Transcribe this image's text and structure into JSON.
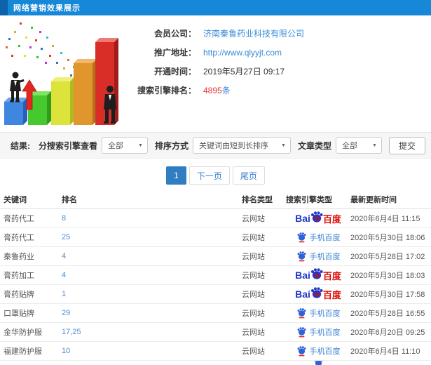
{
  "header": {
    "title": "网络营销效果展示"
  },
  "info": {
    "fields": [
      {
        "label": "会员公司：",
        "value": "济南秦鲁药业科技有限公司"
      },
      {
        "label": "推广地址：",
        "value": "http://www.qlyyjt.com"
      },
      {
        "label": "开通时间：",
        "value": "2019年5月27日 09:17"
      },
      {
        "label": "搜索引擎排名：",
        "value": "4895",
        "suffix": "条"
      }
    ]
  },
  "filters": {
    "result_label": "结果:",
    "engine_label": "分搜索引擎查看",
    "engine_value": "全部",
    "sort_label": "排序方式",
    "sort_value": "关键词由短到长排序",
    "article_label": "文章类型",
    "article_value": "全部",
    "submit_label": "提交"
  },
  "icons": {
    "dropdown_caret": "▼"
  },
  "pagination": {
    "current": "1",
    "next_label": "下一页",
    "last_label": "尾页"
  },
  "logos": {
    "baidu": {
      "bai": "Bai",
      "du": "du",
      "cn": "百度"
    },
    "mobile": {
      "cn": "手机百度"
    }
  },
  "table": {
    "headers": [
      "关键词",
      "排名",
      "排名类型",
      "搜索引擎类型",
      "最新更新时间"
    ],
    "rows": [
      {
        "keyword": "膏药代工",
        "rank": "8",
        "rank_type": "云网站",
        "engine": "baidu",
        "updated": "2020年6月4日 11:15"
      },
      {
        "keyword": "膏药代工",
        "rank": "25",
        "rank_type": "云网站",
        "engine": "mobile",
        "updated": "2020年5月30日 18:06"
      },
      {
        "keyword": "秦鲁药业",
        "rank": "4",
        "rank_type": "云网站",
        "engine": "mobile",
        "updated": "2020年5月28日 17:02"
      },
      {
        "keyword": "膏药加工",
        "rank": "4",
        "rank_type": "云网站",
        "engine": "baidu",
        "updated": "2020年5月30日 18:03"
      },
      {
        "keyword": "膏药贴牌",
        "rank": "1",
        "rank_type": "云网站",
        "engine": "baidu",
        "updated": "2020年5月30日 17:58"
      },
      {
        "keyword": "口罩贴牌",
        "rank": "29",
        "rank_type": "云网站",
        "engine": "mobile",
        "updated": "2020年5月28日 16:55"
      },
      {
        "keyword": "金华防护服",
        "rank": "17,25",
        "rank_type": "云网站",
        "engine": "mobile",
        "updated": "2020年6月20日 09:25"
      },
      {
        "keyword": "福建防护服",
        "rank": "10",
        "rank_type": "云网站",
        "engine": "mobile",
        "updated": "2020年6月4日 11:10"
      }
    ],
    "partial_row": {
      "engine": "mobile"
    }
  },
  "colors": {
    "header_bg": "#1787d8",
    "header_accent": "#0d62a8",
    "link_blue": "#3a8bd8",
    "rank_red": "#e4393c",
    "active_page_bg": "#2f7ec1",
    "baidu_blue": "#2036c8",
    "baidu_red": "#e10600"
  }
}
